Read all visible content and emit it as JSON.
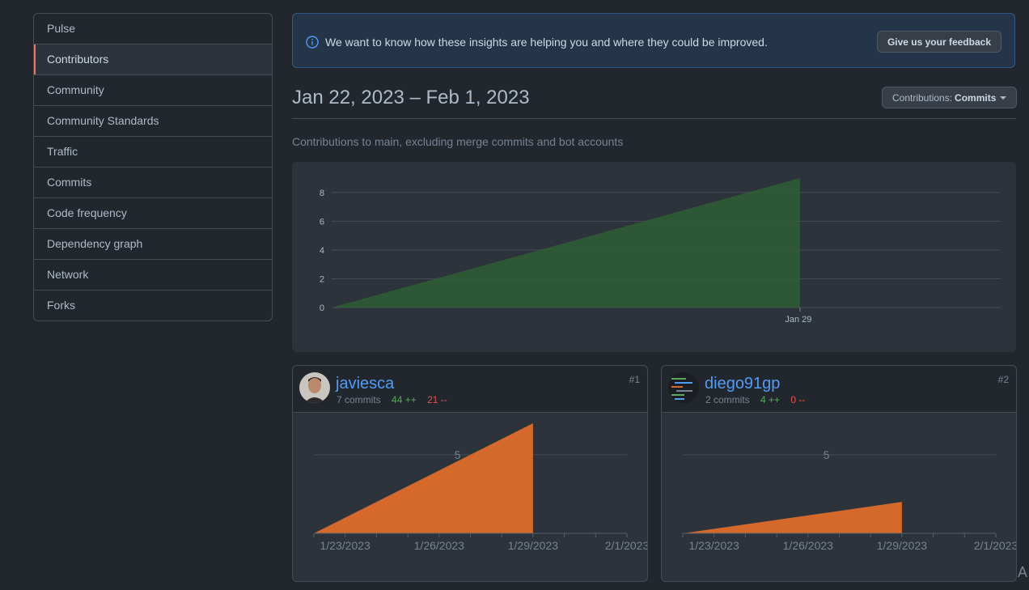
{
  "sidebar": {
    "items": [
      {
        "label": "Pulse"
      },
      {
        "label": "Contributors",
        "selected": true
      },
      {
        "label": "Community"
      },
      {
        "label": "Community Standards"
      },
      {
        "label": "Traffic"
      },
      {
        "label": "Commits"
      },
      {
        "label": "Code frequency"
      },
      {
        "label": "Dependency graph"
      },
      {
        "label": "Network"
      },
      {
        "label": "Forks"
      }
    ]
  },
  "banner": {
    "icon": "info-icon",
    "message": "We want to know how these insights are helping you and where they could be improved.",
    "button_label": "Give us your feedback"
  },
  "header": {
    "date_range": "Jan 22, 2023 – Feb 1, 2023",
    "contributions_prefix": "Contributions:",
    "contributions_value": "Commits",
    "subtitle": "Contributions to main, excluding merge commits and bot accounts"
  },
  "colors": {
    "accent_selected": "#ec775c",
    "main_area": "#2f5e35",
    "contributor_area": "#d4692b",
    "link": "#539bf5",
    "additions": "#57ab5a",
    "deletions": "#e5534b"
  },
  "contributors": [
    {
      "rank": "#1",
      "username": "javiesca",
      "commits": "7 commits",
      "additions": "44 ++",
      "deletions": "21 --"
    },
    {
      "rank": "#2",
      "username": "diego91gp",
      "commits": "2 commits",
      "additions": "4 ++",
      "deletions": "0 --"
    }
  ],
  "corner_glyph": "A",
  "chart_data": [
    {
      "type": "area",
      "x": [
        "2023-01-22",
        "2023-01-29"
      ],
      "values": [
        0,
        9
      ],
      "x_ticks": [
        "Jan 29"
      ],
      "y_ticks": [
        0,
        2,
        4,
        6,
        8
      ],
      "ylim": [
        0,
        9
      ],
      "grid": true
    },
    {
      "type": "area",
      "series": [
        {
          "name": "javiesca",
          "x": [
            "2023-01-22",
            "2023-01-29"
          ],
          "values": [
            0,
            7
          ]
        }
      ],
      "x_ticks": [
        "1/23/2023",
        "1/26/2023",
        "1/29/2023",
        "2/1/2023"
      ],
      "y_ticks": [
        5
      ],
      "ylim": [
        0,
        7
      ],
      "grid": true
    },
    {
      "type": "area",
      "series": [
        {
          "name": "diego91gp",
          "x": [
            "2023-01-22",
            "2023-01-29"
          ],
          "values": [
            0,
            2
          ]
        }
      ],
      "x_ticks": [
        "1/23/2023",
        "1/26/2023",
        "1/29/2023",
        "2/1/2023"
      ],
      "y_ticks": [
        5
      ],
      "ylim": [
        0,
        7
      ],
      "grid": true
    }
  ]
}
